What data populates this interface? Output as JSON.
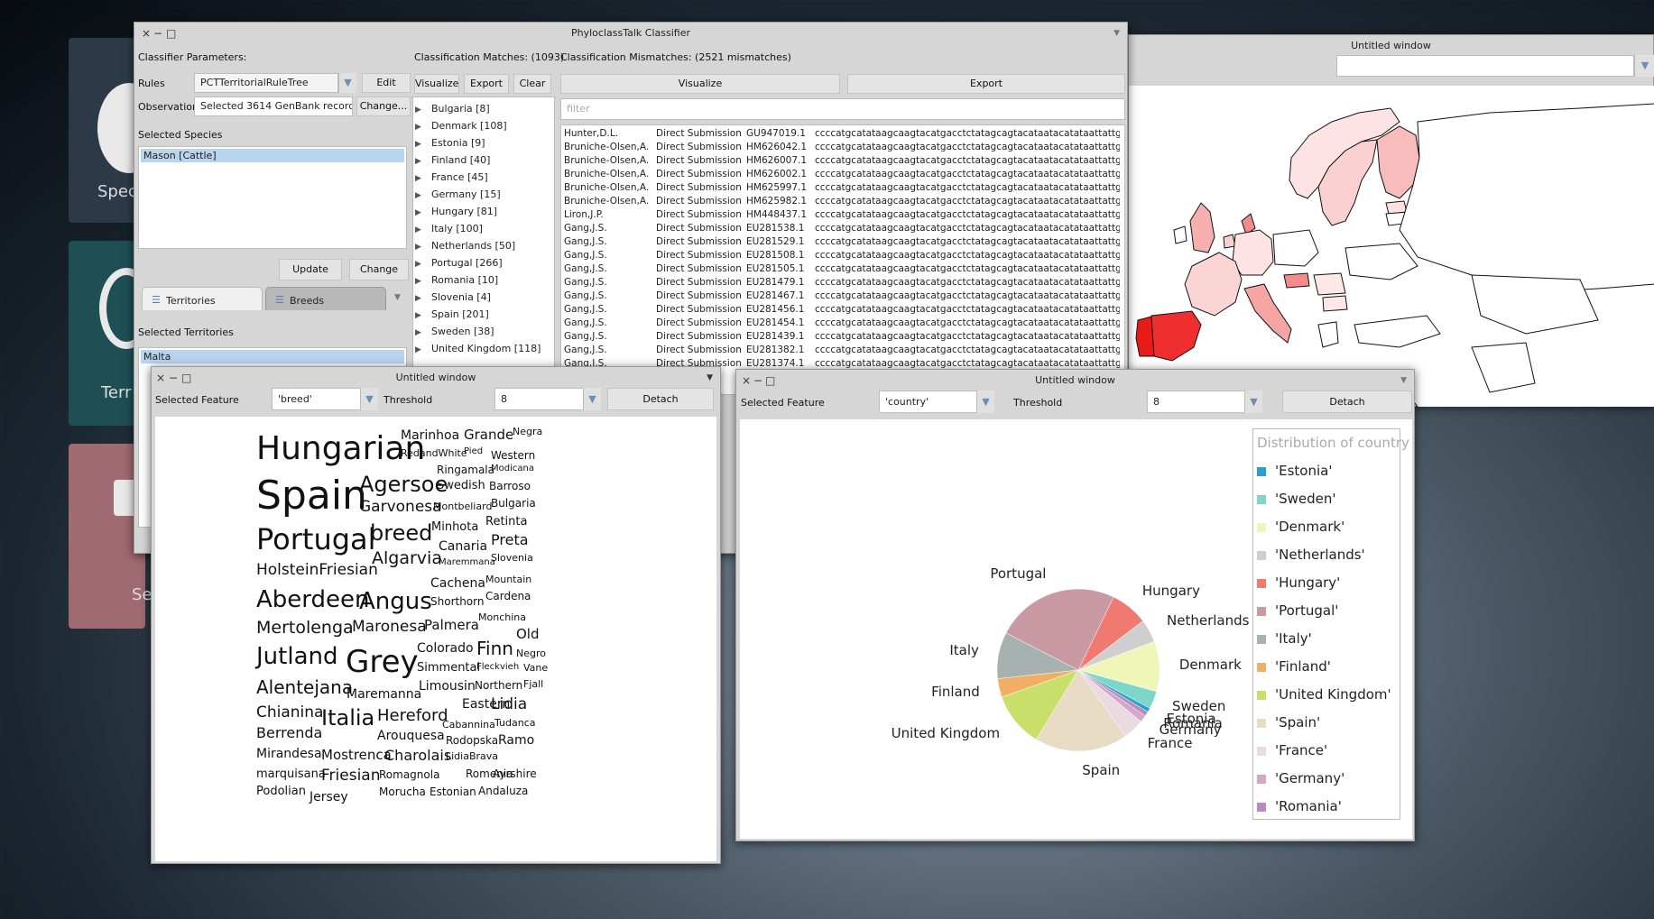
{
  "desktop": {
    "tiles": [
      {
        "label": "Spec",
        "color": "#2c3a48"
      },
      {
        "label": "Terr",
        "color": "#1e4f55"
      },
      {
        "label": "Se",
        "color": "#a06a72"
      }
    ]
  },
  "main_window": {
    "title": "PhyloclassTalk Classifier",
    "classifier_params_label": "Classifier Parameters:",
    "rules_label": "Rules",
    "rules_value": "PCTTerritorialRuleTree",
    "edit_button": "Edit",
    "observation_label": "Observation",
    "observation_value": "Selected 3614 GenBank records",
    "change_obs_button": "Change...",
    "selected_species_label": "Selected Species",
    "species": [
      "Mason [Cattle]"
    ],
    "update_button": "Update",
    "change_button": "Change",
    "tabs": [
      "Territories",
      "Breeds"
    ],
    "selected_territories_label": "Selected Territories",
    "territories": [
      "Malta"
    ],
    "matches_label": "Classification Matches:  (1093)",
    "mismatches_label": "Classification Mismatches: (2521 mismatches)",
    "visualize_button": "Visualize",
    "export_button": "Export",
    "clear_button": "Clear",
    "visualize_button2": "Visualize",
    "export_button2": "Export",
    "filter_placeholder": "filter",
    "match_tree": [
      "Bulgaria [8]",
      "Denmark [108]",
      "Estonia [9]",
      "Finland [40]",
      "France [45]",
      "Germany [15]",
      "Hungary [81]",
      "Italy [100]",
      "Netherlands [50]",
      "Portugal [266]",
      "Romania [10]",
      "Slovenia [4]",
      "Spain [201]",
      "Sweden [38]",
      "United Kingdom [118]"
    ],
    "mismatch_rows": [
      {
        "author": "Hunter,D.L.",
        "type": "Direct Submission",
        "acc": "GU947019.1",
        "seq": "ccccatgcatataagcaagtacatgacctctatagcagtacataatacatataattattgactgt"
      },
      {
        "author": "Bruniche-Olsen,A.",
        "type": "Direct Submission",
        "acc": "HM626042.1",
        "seq": "ccccatgcatataagcaagtacatgacctctatagcagtacataatacatataattattgactgt"
      },
      {
        "author": "Bruniche-Olsen,A.",
        "type": "Direct Submission",
        "acc": "HM626007.1",
        "seq": "ccccatgcatataagcaagtacatgacctctatagcagtacataatacatataattattgactgt"
      },
      {
        "author": "Bruniche-Olsen,A.",
        "type": "Direct Submission",
        "acc": "HM626002.1",
        "seq": "ccccatgcatataagcaagtacatgacctctatagcagtacataatacatataattattgactgt"
      },
      {
        "author": "Bruniche-Olsen,A.",
        "type": "Direct Submission",
        "acc": "HM625997.1",
        "seq": "ccccatgcatataagcaagtacatgacctctatagcagtacataatacatataattattgactgt"
      },
      {
        "author": "Bruniche-Olsen,A.",
        "type": "Direct Submission",
        "acc": "HM625982.1",
        "seq": "ccccatgcatataagcaagtacatgacctctatagcagtacataatacatataattattgactgt"
      },
      {
        "author": "Liron,J.P.",
        "type": "Direct Submission",
        "acc": "HM448437.1",
        "seq": "ccccatgcatataagcaagtacatgacctctatagcagtacataatacatataattattgactgt"
      },
      {
        "author": "Gang,J.S.",
        "type": "Direct Submission",
        "acc": "EU281538.1",
        "seq": "ccccatgcatataagcaagtacatgacctctatagcagtacataatacatataattattgactgt"
      },
      {
        "author": "Gang,J.S.",
        "type": "Direct Submission",
        "acc": "EU281529.1",
        "seq": "ccccatgcatataagcaagtacatgacctctatagcagtacataatacatataattattgactgt"
      },
      {
        "author": "Gang,J.S.",
        "type": "Direct Submission",
        "acc": "EU281508.1",
        "seq": "ccccatgcatataagcaagtacatgacctctatagcagtacataatacatataattattgactgt"
      },
      {
        "author": "Gang,J.S.",
        "type": "Direct Submission",
        "acc": "EU281505.1",
        "seq": "ccccatgcatataagcaagtacatgacctctatagcagtacataatacatataattattgactgt"
      },
      {
        "author": "Gang,J.S.",
        "type": "Direct Submission",
        "acc": "EU281479.1",
        "seq": "ccccatgcatataagcaagtacatgacctctatagcagtacataatacatataattattgactgt"
      },
      {
        "author": "Gang,J.S.",
        "type": "Direct Submission",
        "acc": "EU281467.1",
        "seq": "ccccatgcatataagcaagtacatgacctctatagcagtacataatacatataattattgactgt"
      },
      {
        "author": "Gang,J.S.",
        "type": "Direct Submission",
        "acc": "EU281456.1",
        "seq": "ccccatgcatataagcaagtacatgacctctatagcagtacataatacatataattattgactgt"
      },
      {
        "author": "Gang,J.S.",
        "type": "Direct Submission",
        "acc": "EU281454.1",
        "seq": "ccccatgcatataagcaagtacatgacctctatagcagtacataatacatataattattgactgt"
      },
      {
        "author": "Gang,J.S.",
        "type": "Direct Submission",
        "acc": "EU281439.1",
        "seq": "ccccatgcatataagcaagtacatgacctctatagcagtacataatacatataattattgactgt"
      },
      {
        "author": "Gang,J.S.",
        "type": "Direct Submission",
        "acc": "EU281382.1",
        "seq": "ccccatgcatataagcaagtacatgacctctatagcagtacataatacatataattattgactgt"
      },
      {
        "author": "Gang,J.S.",
        "type": "Direct Submission",
        "acc": "EU281374.1",
        "seq": "ccccatgcatataagcaagtacatgacctctatagcagtacataatacatataattattgactgt"
      }
    ]
  },
  "map_window": {
    "title": "Untitled window"
  },
  "breed_window": {
    "title": "Untitled window",
    "selected_feature_label": "Selected Feature",
    "feature_value": "'breed'",
    "threshold_label": "Threshold",
    "threshold_value": "8",
    "detach_button": "Detach",
    "words": [
      "Hungarian",
      "Marinhoa",
      "Grande",
      "Negra",
      "RedandWhite",
      "Pied",
      "Western",
      "Ringamala",
      "Modicana",
      "Spain",
      "Agersoe",
      "Swedish",
      "Barroso",
      "Garvonesa",
      "Montbeliard",
      "Bulgaria",
      "Retinta",
      "Portugal",
      "breed",
      "Minhota",
      "Canaria",
      "Preta",
      "Algarvia",
      "Maremmana",
      "Slovenia",
      "HolsteinFriesian",
      "Cachena",
      "Mountain",
      "Cardena",
      "Aberdeen",
      "Angus",
      "Shorthorn",
      "Monchina",
      "Mertolenga",
      "Maronesa",
      "Palmera",
      "Old",
      "Colorado",
      "Finn",
      "Negro",
      "Jutland",
      "Grey",
      "Simmental",
      "Fleckvieh",
      "Vane",
      "Alentejana",
      "Limousin",
      "Northern",
      "Fjall",
      "Maremanna",
      "Chianina",
      "Italia",
      "Eastern",
      "Lidia",
      "Hereford",
      "Cabannina",
      "Tudanca",
      "Berrenda",
      "Arouquesa",
      "Rodopska",
      "Ramo",
      "Mirandesa",
      "Mostrenca",
      "Charolais",
      "LidiaBrava",
      "marquisana",
      "Friesian",
      "Romagnola",
      "Romenia",
      "Ayrshire",
      "Podolian",
      "Morucha",
      "Estonian",
      "Andaluza",
      "Jersey"
    ]
  },
  "country_window": {
    "title": "Untitled window",
    "selected_feature_label": "Selected Feature",
    "feature_value": "'country'",
    "threshold_label": "Threshold",
    "threshold_value": "8",
    "detach_button": "Detach",
    "legend_title": "Distribution of country"
  },
  "chart_data": {
    "type": "pie",
    "title": "Distribution of country",
    "categories": [
      "Estonia",
      "Sweden",
      "Denmark",
      "Netherlands",
      "Hungary",
      "Portugal",
      "Italy",
      "Finland",
      "United Kingdom",
      "Spain",
      "France",
      "Germany",
      "Romania"
    ],
    "legend_labels": [
      "'Estonia'",
      "'Sweden'",
      "'Denmark'",
      "'Netherlands'",
      "'Hungary'",
      "'Portugal'",
      "'Italy'",
      "'Finland'",
      "'United Kingdom'",
      "'Spain'",
      "'France'",
      "'Germany'",
      "'Romania'"
    ],
    "values": [
      9,
      38,
      108,
      50,
      81,
      266,
      100,
      40,
      118,
      201,
      45,
      15,
      10
    ],
    "colors": [
      "#2a9fd6",
      "#7ed6c8",
      "#f0f5b8",
      "#cfcfcf",
      "#f07a72",
      "#c99aa4",
      "#a7b2b0",
      "#f2ae62",
      "#c8df6a",
      "#e8dcc4",
      "#eadbe2",
      "#d3a6cb",
      "#b98db9"
    ],
    "legend": "right"
  }
}
